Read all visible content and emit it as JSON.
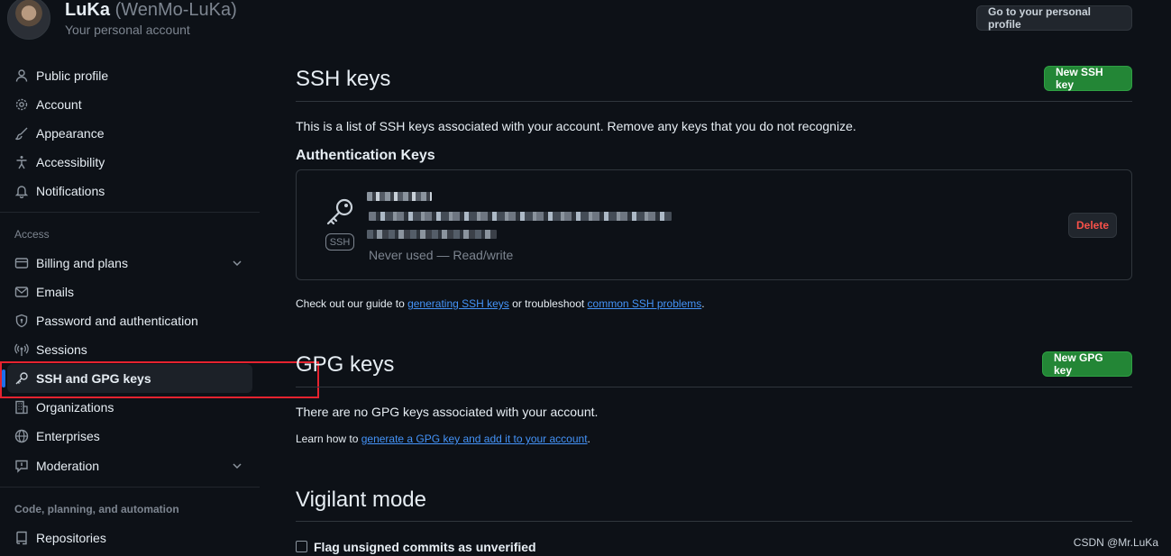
{
  "profile": {
    "name": "LuKa",
    "login": "(WenMo-LuKa)",
    "subtitle": "Your personal account",
    "go_to_profile": "Go to your personal profile"
  },
  "sidebar": {
    "items_top": [
      {
        "label": "Public profile",
        "icon": "person-icon"
      },
      {
        "label": "Account",
        "icon": "gear-icon"
      },
      {
        "label": "Appearance",
        "icon": "paintbrush-icon"
      },
      {
        "label": "Accessibility",
        "icon": "accessibility-icon"
      },
      {
        "label": "Notifications",
        "icon": "bell-icon"
      }
    ],
    "access_title": "Access",
    "items_access": [
      {
        "label": "Billing and plans",
        "icon": "credit-card-icon",
        "expandable": true
      },
      {
        "label": "Emails",
        "icon": "mail-icon"
      },
      {
        "label": "Password and authentication",
        "icon": "shield-lock-icon"
      },
      {
        "label": "Sessions",
        "icon": "broadcast-icon"
      },
      {
        "label": "SSH and GPG keys",
        "icon": "key-icon",
        "active": true
      },
      {
        "label": "Organizations",
        "icon": "organization-icon"
      },
      {
        "label": "Enterprises",
        "icon": "globe-icon"
      },
      {
        "label": "Moderation",
        "icon": "report-icon",
        "expandable": true
      }
    ],
    "code_title": "Code, planning, and automation",
    "items_code": [
      {
        "label": "Repositories",
        "icon": "repo-icon"
      }
    ]
  },
  "ssh": {
    "heading": "SSH keys",
    "new_button": "New SSH key",
    "description": "This is a list of SSH keys associated with your account. Remove any keys that you do not recognize.",
    "auth_heading": "Authentication Keys",
    "key_badge": "SSH",
    "key_meta": "Never used — Read/write",
    "delete_button": "Delete",
    "guide_prefix": "Check out our guide to ",
    "guide_link1": "generating SSH keys",
    "guide_middle": " or troubleshoot ",
    "guide_link2": "common SSH problems",
    "guide_suffix": "."
  },
  "gpg": {
    "heading": "GPG keys",
    "new_button": "New GPG key",
    "empty_text": "There are no GPG keys associated with your account.",
    "learn_prefix": "Learn how to ",
    "learn_link": "generate a GPG key and add it to your account",
    "learn_suffix": "."
  },
  "vigilant": {
    "heading": "Vigilant mode",
    "checkbox_label": "Flag unsigned commits as unverified"
  },
  "watermark": "CSDN @Mr.LuKa"
}
